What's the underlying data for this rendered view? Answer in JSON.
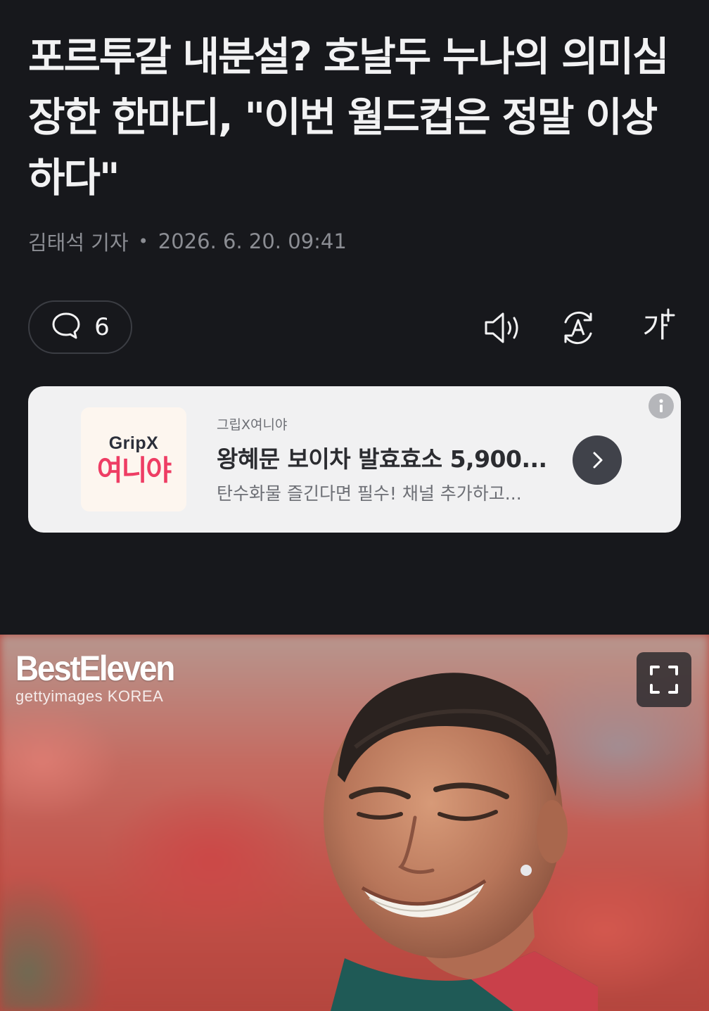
{
  "article": {
    "title": "포르투갈 내분설? 호날두 누나의 의미심장한 한마디, \"이번 월드컵은 정말 이상하다\"",
    "reporter": "김태석 기자",
    "date": "2026. 6. 20. 09:41"
  },
  "toolbar": {
    "comment_count": "6",
    "font_size_label": "가"
  },
  "ad": {
    "logo_top": "GripX",
    "logo_main": "여니야",
    "advertiser": "그립X여니야",
    "title": "왕혜문 보이차 발효효소 5,900...",
    "description": "탄수화물 즐긴다면 필수! 채널 추가하고..."
  },
  "photo": {
    "watermark_main": "BestEleven",
    "watermark_sub": "gettyimages KOREA"
  },
  "colors": {
    "background": "#17181c",
    "ad_card": "#f1f1f2",
    "brand_pink": "#ee3d64"
  }
}
